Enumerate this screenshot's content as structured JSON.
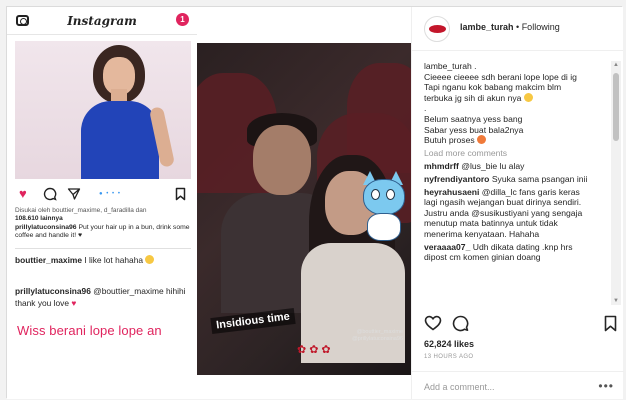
{
  "header": {
    "username": "lambe_turah",
    "separator": " • ",
    "follow_status": "Following"
  },
  "screenshot": {
    "logo": "Instagram",
    "notif_count": "1",
    "liked_by": "Disukai oleh bouttier_maxime, d_faradilla dan",
    "liked_by_count": "108.610 lainnya",
    "caption_user": "prillylatuconsina96",
    "caption_text": "Put your hair up in a bun, drink some coffee and handle it! ♥",
    "reply1_user": "bouttier_maxime",
    "reply1_text": "I like lot hahaha",
    "reply2_user": "prillylatuconsina96",
    "reply2_mention": "@bouttier_maxime",
    "reply2_text": "hihihi thank you love",
    "overlay_text": "Wiss berani lope lope an",
    "story_text": "Insidious time",
    "tag1": "@bouttier_maxime",
    "tag2": "@prillylatuconsina96"
  },
  "caption": {
    "user": "lambe_turah .",
    "lines": [
      "Cieeee cieeee sdh berani lope lope di ig",
      "Tapi nganu kok babang makcim blm",
      "terbuka jg sih di akun nya",
      ".",
      "Belum saatnya yess bang",
      "Sabar yess buat bala2nya",
      "Butuh proses"
    ]
  },
  "load_more": "Load more comments",
  "comments": [
    {
      "user": "mhmdrff",
      "lines": [
        "@lus_bie lu alay"
      ]
    },
    {
      "user": "nyfrendiyantoro",
      "lines": [
        "Syuka sama psangan inii"
      ]
    },
    {
      "user": "heyrahusaeni",
      "lines": [
        "@dilla_lc fans garis keras",
        "lagi ngasih wejangan buat dirinya sendiri.",
        "Justru anda @susikustiyani yang sengaja",
        "menutup mata batinnya untuk tidak",
        "menerima kenyataan. Hahaha"
      ]
    },
    {
      "user": "veraaaa07_",
      "lines": [
        "Udh dikata dating .knp hrs",
        "dipost cm komen ginian doang"
      ]
    }
  ],
  "likes": "62,824 likes",
  "time": "13 HOURS AGO",
  "add_comment": {
    "placeholder": "Add a comment..."
  }
}
